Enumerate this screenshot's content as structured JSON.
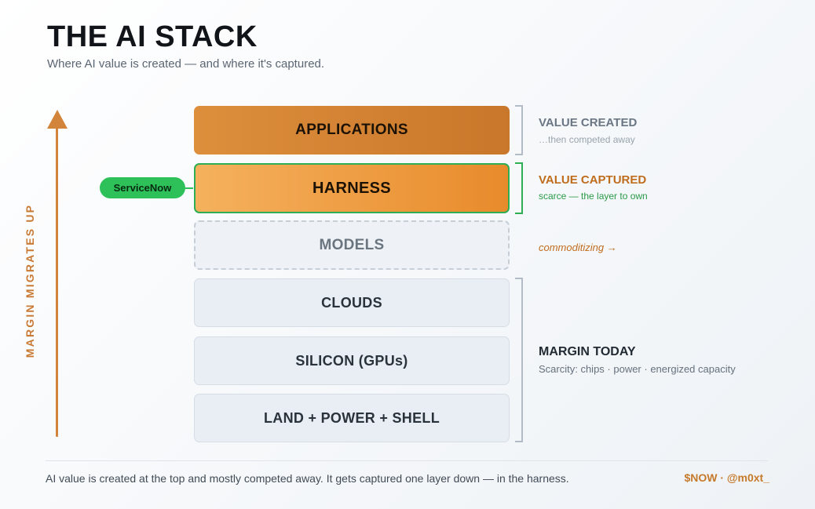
{
  "header": {
    "title": "THE AI STACK",
    "subtitle": "Where AI value is created — and where it's captured."
  },
  "axis": {
    "label": "MARGIN MIGRATES UP"
  },
  "stack": {
    "layers": [
      {
        "label": "APPLICATIONS"
      },
      {
        "label": "HARNESS"
      },
      {
        "label": "MODELS"
      },
      {
        "label": "CLOUDS"
      },
      {
        "label": "SILICON (GPUs)"
      },
      {
        "label": "LAND + POWER + SHELL"
      }
    ]
  },
  "pill": {
    "label": "ServiceNow"
  },
  "notes": {
    "created": {
      "title": "VALUE CREATED",
      "sub": "…then competed away"
    },
    "captured": {
      "title": "VALUE CAPTURED",
      "sub": "scarce — the layer to own"
    },
    "commoditizing": "commoditizing →",
    "margin": {
      "title": "MARGIN TODAY",
      "sub": "Scarcity: chips · power · energized capacity"
    }
  },
  "footer": {
    "text": "AI value is created at the top and mostly competed away. It gets captured one layer down — in the harness.",
    "credit": "$NOW · @m0xt_"
  },
  "colors": {
    "accent_orange": "#d1843a",
    "harness_green": "#2fae55",
    "pill_green": "#2ec15a"
  }
}
